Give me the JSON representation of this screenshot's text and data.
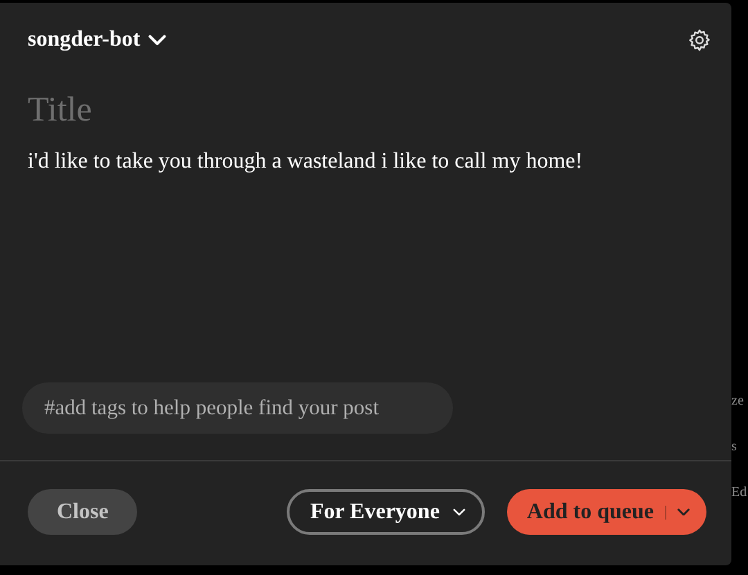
{
  "blog": {
    "name": "songder-bot"
  },
  "post": {
    "title_placeholder": "Title",
    "body": "i'd like to take you through a wasteland i like to call my home!"
  },
  "tags": {
    "placeholder": "#add tags to help people find your post"
  },
  "footer": {
    "close": "Close",
    "audience": "For Everyone",
    "submit": "Add to queue"
  },
  "background_fragments": [
    "ze",
    "s",
    "Ed"
  ]
}
